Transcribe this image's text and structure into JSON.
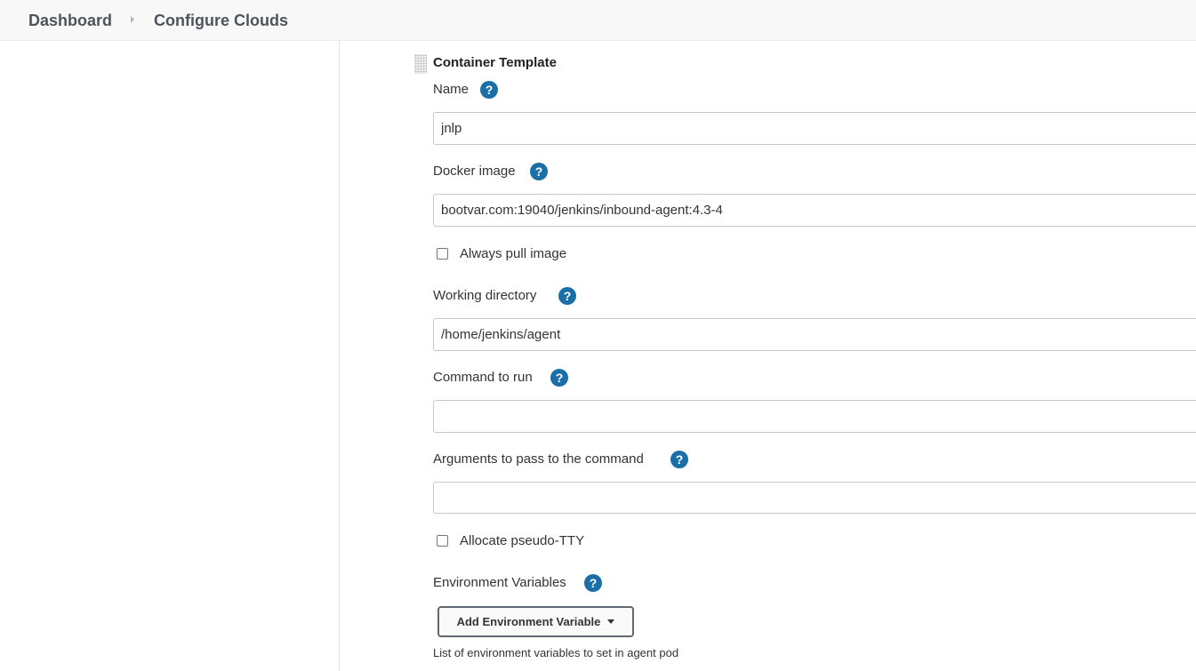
{
  "breadcrumb": {
    "items": [
      "Dashboard",
      "Configure Clouds"
    ]
  },
  "container_template": {
    "title": "Container Template",
    "help_glyph": "?",
    "name": {
      "label": "Name",
      "value": "jnlp"
    },
    "docker_image": {
      "label": "Docker image",
      "value": "bootvar.com:19040/jenkins/inbound-agent:4.3-4"
    },
    "always_pull": {
      "label": "Always pull image",
      "checked": false
    },
    "working_directory": {
      "label": "Working directory",
      "value": "/home/jenkins/agent"
    },
    "command": {
      "label": "Command to run",
      "value": ""
    },
    "arguments": {
      "label": "Arguments to pass to the command",
      "value": ""
    },
    "pseudo_tty": {
      "label": "Allocate pseudo-TTY",
      "checked": false
    },
    "env_vars": {
      "label": "Environment Variables",
      "add_button": "Add Environment Variable",
      "hint": "List of environment variables to set in agent pod"
    }
  },
  "colors": {
    "help_icon": "#1a6fa8",
    "breadcrumb_bg": "#f8f8f8",
    "breadcrumb_text": "#4d545d"
  },
  "icons": {
    "help": "help-icon",
    "separator": "chevron-right-icon",
    "drag": "drag-handle-icon",
    "dropdown": "caret-down-icon"
  }
}
